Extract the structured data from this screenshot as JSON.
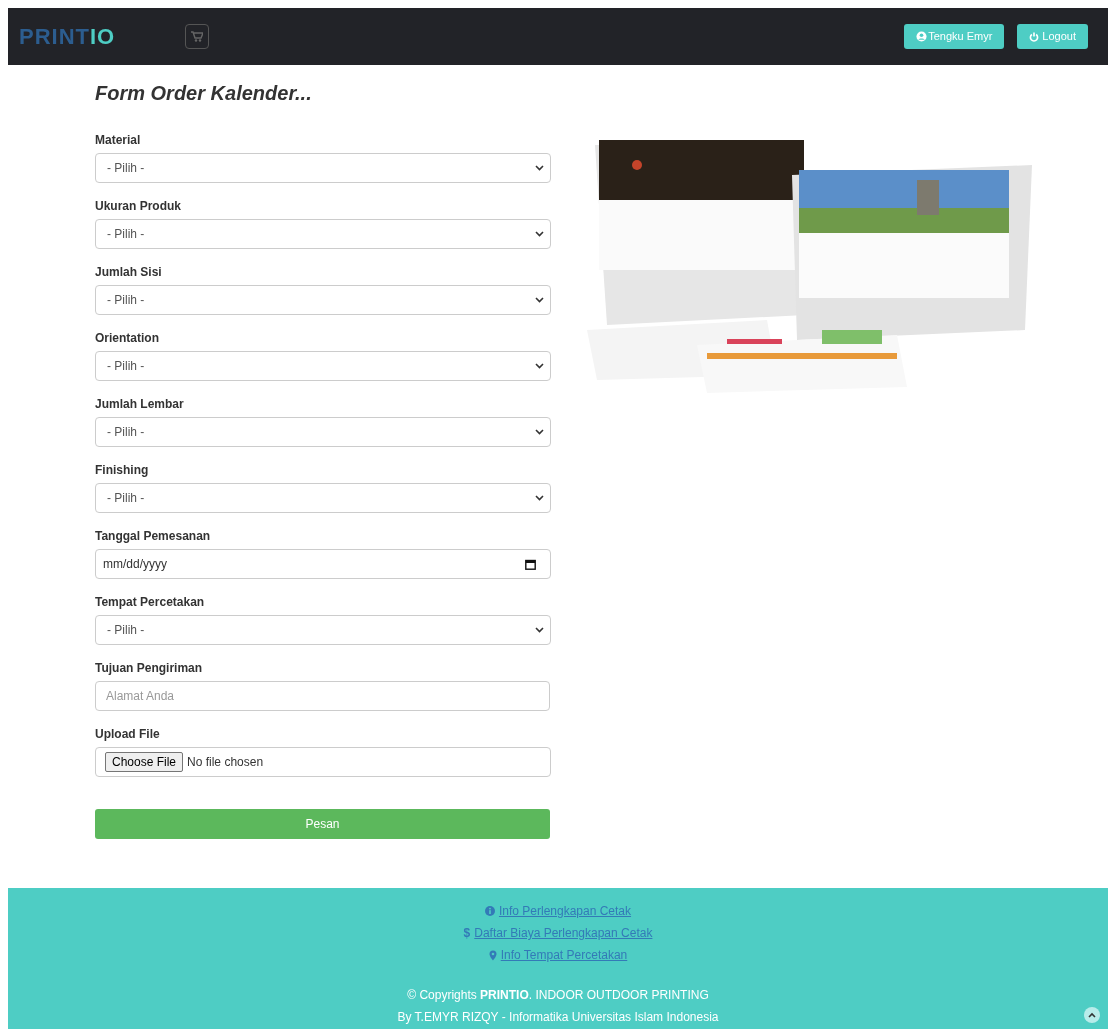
{
  "navbar": {
    "logo": [
      "PRINT",
      "IO"
    ],
    "user_button": "Tengku Emyr",
    "logout_button": "Logout"
  },
  "form": {
    "title": "Form Order Kalender...",
    "fields": [
      {
        "kind": "select",
        "label": "Material",
        "value": "- Pilih -"
      },
      {
        "kind": "select",
        "label": "Ukuran Produk",
        "value": "- Pilih -"
      },
      {
        "kind": "select",
        "label": "Jumlah Sisi",
        "value": "- Pilih -"
      },
      {
        "kind": "select",
        "label": "Orientation",
        "value": "- Pilih -"
      },
      {
        "kind": "select",
        "label": "Jumlah Lembar",
        "value": "- Pilih -"
      },
      {
        "kind": "select",
        "label": "Finishing",
        "value": "- Pilih -"
      },
      {
        "kind": "date",
        "label": "Tanggal Pemesanan",
        "value": "mm/dd/yyyy"
      },
      {
        "kind": "select",
        "label": "Tempat Percetakan",
        "value": "- Pilih -"
      },
      {
        "kind": "text",
        "label": "Tujuan Pengiriman",
        "placeholder": "Alamat Anda"
      },
      {
        "kind": "file",
        "label": "Upload File",
        "button": "Choose File",
        "value": "No file chosen"
      }
    ],
    "submit": "Pesan"
  },
  "footer": {
    "links": [
      {
        "kind": "info",
        "label": "Info Perlengkapan Cetak"
      },
      {
        "kind": "price",
        "symbol": "$",
        "label": "Daftar Biaya Perlengkapan Cetak"
      },
      {
        "kind": "location",
        "label": "Info Tempat Percetakan"
      }
    ],
    "copyright": "© Copyrights **PRINTIO**. INDOOR OUTDOOR PRINTING",
    "credit": "By T.EMYR RIZQY - Informatika Universitas Islam Indonesia"
  }
}
